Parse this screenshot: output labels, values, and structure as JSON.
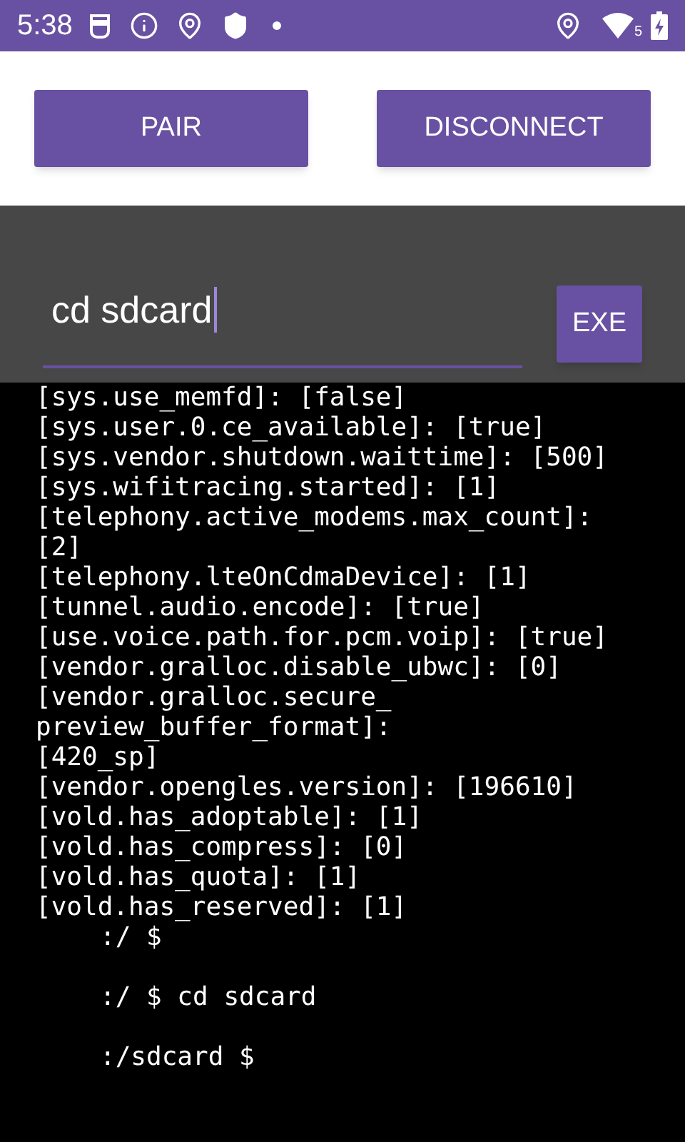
{
  "status_bar": {
    "time": "5:38",
    "wifi_badge": "5"
  },
  "buttons": [
    {
      "label": "PAIR"
    },
    {
      "label": "DISCONNECT"
    }
  ],
  "command": {
    "value": "cd sdcard",
    "focused": true
  },
  "exec_button": {
    "label": "EXE"
  },
  "terminal": {
    "lines": [
      {
        "kind": "output",
        "text": "[sys.use_memfd]: [false]"
      },
      {
        "kind": "output",
        "text": "[sys.user.0.ce_available]: [true]"
      },
      {
        "kind": "output",
        "text": "[sys.vendor.shutdown.waittime]: [500]"
      },
      {
        "kind": "output",
        "text": "[sys.wifitracing.started]: [1]"
      },
      {
        "kind": "output",
        "text": "[telephony.active_modems.max_count]:"
      },
      {
        "kind": "output",
        "text": "[2]"
      },
      {
        "kind": "output",
        "text": "[telephony.lteOnCdmaDevice]: [1]"
      },
      {
        "kind": "output",
        "text": "[tunnel.audio.encode]: [true]"
      },
      {
        "kind": "output",
        "text": "[use.voice.path.for.pcm.voip]: [true]"
      },
      {
        "kind": "output",
        "text": "[vendor.gralloc.disable_ubwc]: [0]"
      },
      {
        "kind": "output",
        "text": "[vendor.gralloc.secure_"
      },
      {
        "kind": "output",
        "text": "preview_buffer_format]:"
      },
      {
        "kind": "output",
        "text": "[420_sp]"
      },
      {
        "kind": "output",
        "text": "[vendor.opengles.version]: [196610]"
      },
      {
        "kind": "output",
        "text": "[vold.has_adoptable]: [1]"
      },
      {
        "kind": "output",
        "text": "[vold.has_compress]: [0]"
      },
      {
        "kind": "output",
        "text": "[vold.has_quota]: [1]"
      },
      {
        "kind": "output",
        "text": "[vold.has_reserved]: [1]"
      },
      {
        "kind": "prompt",
        "text": ":/ $"
      },
      {
        "kind": "prompt",
        "text": ":/ $ cd sdcard"
      },
      {
        "kind": "prompt",
        "text": ":/sdcard $"
      }
    ]
  }
}
